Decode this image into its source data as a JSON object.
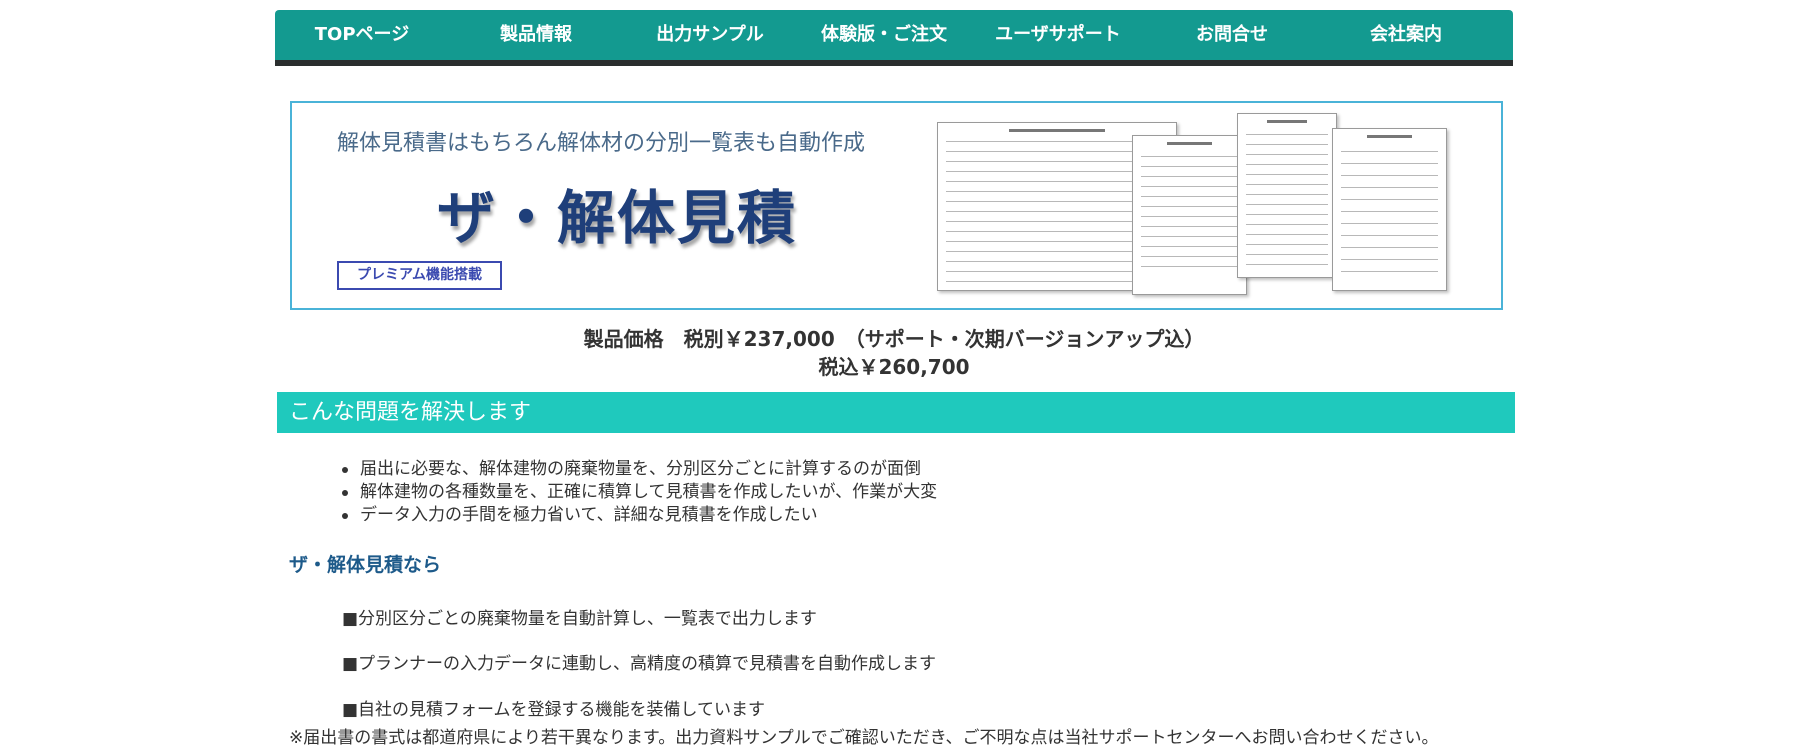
{
  "nav": {
    "items": [
      "TOPページ",
      "製品情報",
      "出力サンプル",
      "体験版・ご注文",
      "ユーザサポート",
      "お問合せ",
      "会社案内"
    ]
  },
  "banner": {
    "tagline": "解体見積書はもちろん解体材の分別一覧表も自動作成",
    "title": "ザ・解体見積",
    "badge": "プレミアム機能搭載"
  },
  "price": {
    "line1": "製品価格　税別￥237,000　（サポート・次期バージョンアップ込）",
    "line2": "税込￥260,700"
  },
  "section": {
    "title": "こんな問題を解決します",
    "problems": [
      "届出に必要な、解体建物の廃棄物量を、分別区分ごとに計算するのが面倒",
      "解体建物の各種数量を、正確に積算して見積書を作成したいが、作業が大変",
      "データ入力の手間を極力省いて、詳細な見積書を作成したい"
    ],
    "solution_heading": "ザ・解体見積なら",
    "features": [
      "■分別区分ごとの廃棄物量を自動計算し、一覧表で出力します",
      "■プランナーの入力データに連動し、高精度の積算で見積書を自動作成します",
      "■自社の見積フォームを登録する機能を装備しています"
    ],
    "note": "※届出書の書式は都道府県により若干異なります。出力資料サンプルでご確認いただき、ご不明な点は当社サポートセンターへお問い合わせください。"
  },
  "colors": {
    "nav_bg": "#139a90",
    "nav_border": "#2a2e2e",
    "section_bar": "#1fc9bd",
    "banner_border": "#4ab3d8",
    "title_color": "#1f3f7a",
    "sub_heading": "#1d5a8a"
  }
}
